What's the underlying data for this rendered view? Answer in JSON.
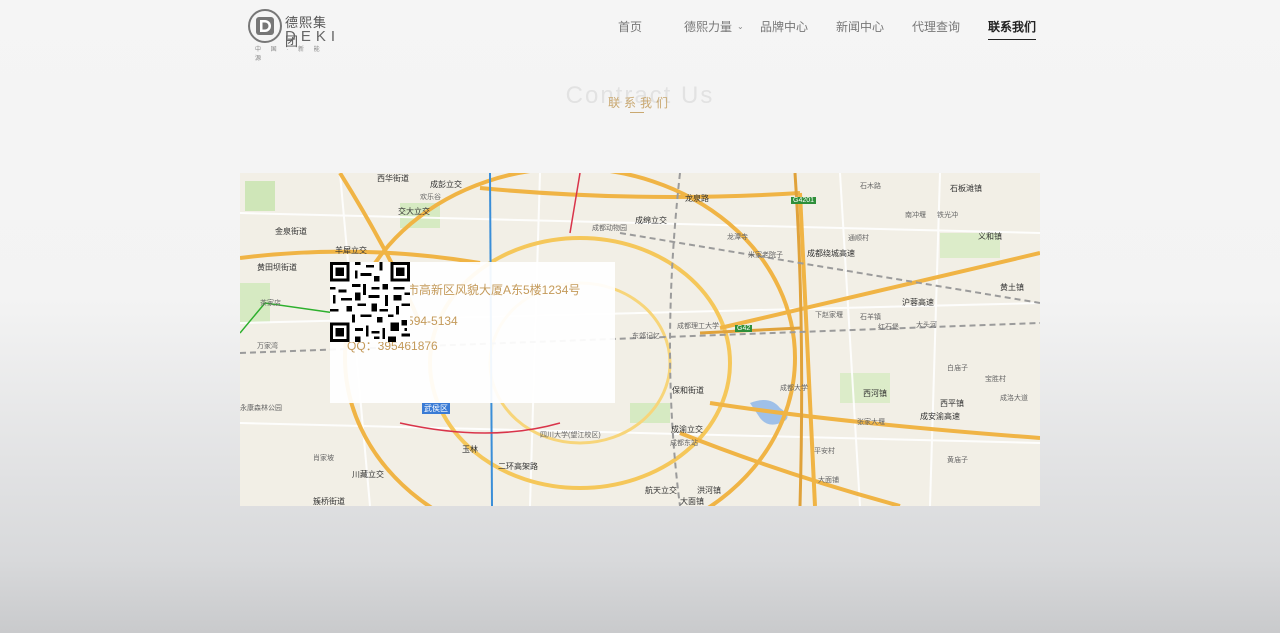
{
  "brand": {
    "name_cn": "德熙集团",
    "name_en": "DEKI",
    "tagline": "中 国 · 新 能 源"
  },
  "nav": {
    "items": [
      {
        "label": "首页",
        "active": false
      },
      {
        "label": "德熙力量",
        "active": false,
        "has_dropdown": true
      },
      {
        "label": "品牌中心",
        "active": false
      },
      {
        "label": "新闻中心",
        "active": false
      },
      {
        "label": "代理查询",
        "active": false
      },
      {
        "label": "联系我们",
        "active": true
      }
    ]
  },
  "section": {
    "title_en": "Contract Us",
    "title_cn": "联系我们"
  },
  "contact": {
    "address": "地址：成都市高新区风貌大厦A东5楼1234号",
    "phone": "电话：400-594-5134",
    "qq": "QQ：395461876"
  },
  "map": {
    "labels": [
      "西华街道",
      "成彭立交",
      "欢乐谷",
      "交大立交",
      "金泉街道",
      "羊犀立交",
      "黄田坝街道",
      "茶家店",
      "万家湾",
      "永康森林公园",
      "肖家坡",
      "川藏立交",
      "簇桥街道",
      "武侯区",
      "玉林",
      "二环高架路",
      "四川大学(望江校区)",
      "成都动物园",
      "成绵立交",
      "龙泉路",
      "龙潭寺",
      "米家老院子",
      "东郊记忆",
      "成都理工大学",
      "保和街道",
      "成都大学",
      "成渝立交",
      "成都东站",
      "航天立交",
      "洪河镇",
      "大面镇",
      "石板滩镇",
      "义和镇",
      "黄土镇",
      "下赵家堰",
      "石羊镇",
      "红石堡",
      "大头河",
      "西河镇",
      "西平镇",
      "张家大堰",
      "白庙子",
      "宝胜村",
      "成洛大道",
      "成安渝高速",
      "沪蓉高速",
      "成都绕城高速",
      "G4201",
      "G42",
      "平安村",
      "大面铺",
      "石木路",
      "南冲堰",
      "铁光冲",
      "通顺村",
      "成都东站",
      "黄庙子"
    ]
  },
  "colors": {
    "accent": "#c9a870",
    "contact_text": "#c49a5a",
    "nav_active": "#222222",
    "nav_inactive": "#777777"
  }
}
